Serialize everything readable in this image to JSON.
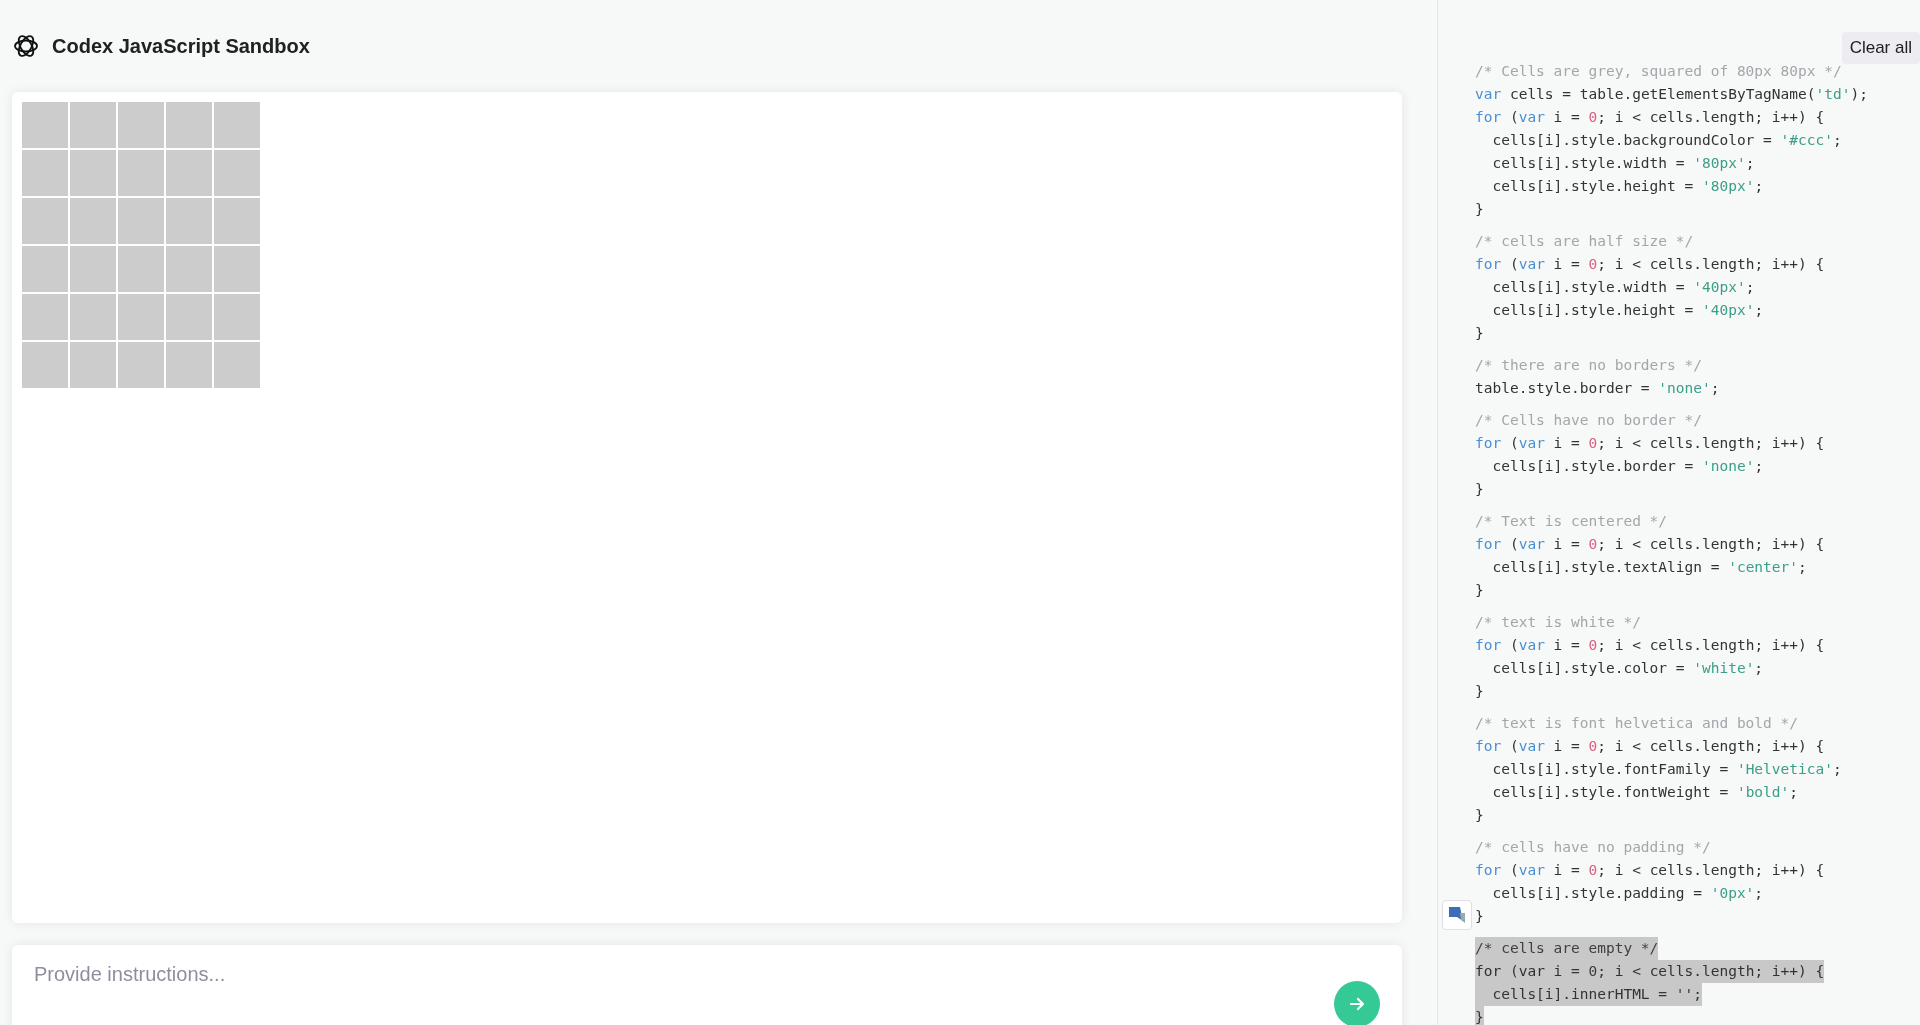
{
  "header": {
    "title": "Codex JavaScript Sandbox"
  },
  "prompt": {
    "placeholder": "Provide instructions..."
  },
  "code_panel": {
    "clear_button": "Clear all",
    "blocks": [
      {
        "selected": false,
        "lines": [
          [
            {
              "kind": "comment",
              "text": "/* Cells are grey, squared of 80px 80px */"
            }
          ],
          [
            {
              "kind": "keyword",
              "text": "var"
            },
            {
              "kind": "plain",
              "text": " cells = table.getElementsByTagName("
            },
            {
              "kind": "string",
              "text": "'td'"
            },
            {
              "kind": "plain",
              "text": ");"
            }
          ],
          [
            {
              "kind": "keyword",
              "text": "for"
            },
            {
              "kind": "plain",
              "text": " ("
            },
            {
              "kind": "keyword",
              "text": "var"
            },
            {
              "kind": "plain",
              "text": " i = "
            },
            {
              "kind": "number",
              "text": "0"
            },
            {
              "kind": "plain",
              "text": "; i < cells.length; i++) {"
            }
          ],
          [
            {
              "kind": "plain",
              "text": "  cells[i].style.backgroundColor = "
            },
            {
              "kind": "string",
              "text": "'#ccc'"
            },
            {
              "kind": "plain",
              "text": ";"
            }
          ],
          [
            {
              "kind": "plain",
              "text": "  cells[i].style.width = "
            },
            {
              "kind": "string",
              "text": "'80px'"
            },
            {
              "kind": "plain",
              "text": ";"
            }
          ],
          [
            {
              "kind": "plain",
              "text": "  cells[i].style.height = "
            },
            {
              "kind": "string",
              "text": "'80px'"
            },
            {
              "kind": "plain",
              "text": ";"
            }
          ],
          [
            {
              "kind": "plain",
              "text": "}"
            }
          ]
        ]
      },
      {
        "selected": false,
        "lines": [
          [
            {
              "kind": "comment",
              "text": "/* cells are half size */"
            }
          ],
          [
            {
              "kind": "keyword",
              "text": "for"
            },
            {
              "kind": "plain",
              "text": " ("
            },
            {
              "kind": "keyword",
              "text": "var"
            },
            {
              "kind": "plain",
              "text": " i = "
            },
            {
              "kind": "number",
              "text": "0"
            },
            {
              "kind": "plain",
              "text": "; i < cells.length; i++) {"
            }
          ],
          [
            {
              "kind": "plain",
              "text": "  cells[i].style.width = "
            },
            {
              "kind": "string",
              "text": "'40px'"
            },
            {
              "kind": "plain",
              "text": ";"
            }
          ],
          [
            {
              "kind": "plain",
              "text": "  cells[i].style.height = "
            },
            {
              "kind": "string",
              "text": "'40px'"
            },
            {
              "kind": "plain",
              "text": ";"
            }
          ],
          [
            {
              "kind": "plain",
              "text": "}"
            }
          ]
        ]
      },
      {
        "selected": false,
        "lines": [
          [
            {
              "kind": "comment",
              "text": "/* there are no borders */"
            }
          ],
          [
            {
              "kind": "plain",
              "text": "table.style.border = "
            },
            {
              "kind": "string",
              "text": "'none'"
            },
            {
              "kind": "plain",
              "text": ";"
            }
          ]
        ]
      },
      {
        "selected": false,
        "lines": [
          [
            {
              "kind": "comment",
              "text": "/* Cells have no border */"
            }
          ],
          [
            {
              "kind": "keyword",
              "text": "for"
            },
            {
              "kind": "plain",
              "text": " ("
            },
            {
              "kind": "keyword",
              "text": "var"
            },
            {
              "kind": "plain",
              "text": " i = "
            },
            {
              "kind": "number",
              "text": "0"
            },
            {
              "kind": "plain",
              "text": "; i < cells.length; i++) {"
            }
          ],
          [
            {
              "kind": "plain",
              "text": "  cells[i].style.border = "
            },
            {
              "kind": "string",
              "text": "'none'"
            },
            {
              "kind": "plain",
              "text": ";"
            }
          ],
          [
            {
              "kind": "plain",
              "text": "}"
            }
          ]
        ]
      },
      {
        "selected": false,
        "lines": [
          [
            {
              "kind": "comment",
              "text": "/* Text is centered */"
            }
          ],
          [
            {
              "kind": "keyword",
              "text": "for"
            },
            {
              "kind": "plain",
              "text": " ("
            },
            {
              "kind": "keyword",
              "text": "var"
            },
            {
              "kind": "plain",
              "text": " i = "
            },
            {
              "kind": "number",
              "text": "0"
            },
            {
              "kind": "plain",
              "text": "; i < cells.length; i++) {"
            }
          ],
          [
            {
              "kind": "plain",
              "text": "  cells[i].style.textAlign = "
            },
            {
              "kind": "string",
              "text": "'center'"
            },
            {
              "kind": "plain",
              "text": ";"
            }
          ],
          [
            {
              "kind": "plain",
              "text": "}"
            }
          ]
        ]
      },
      {
        "selected": false,
        "lines": [
          [
            {
              "kind": "comment",
              "text": "/* text is white */"
            }
          ],
          [
            {
              "kind": "keyword",
              "text": "for"
            },
            {
              "kind": "plain",
              "text": " ("
            },
            {
              "kind": "keyword",
              "text": "var"
            },
            {
              "kind": "plain",
              "text": " i = "
            },
            {
              "kind": "number",
              "text": "0"
            },
            {
              "kind": "plain",
              "text": "; i < cells.length; i++) {"
            }
          ],
          [
            {
              "kind": "plain",
              "text": "  cells[i].style.color = "
            },
            {
              "kind": "string",
              "text": "'white'"
            },
            {
              "kind": "plain",
              "text": ";"
            }
          ],
          [
            {
              "kind": "plain",
              "text": "}"
            }
          ]
        ]
      },
      {
        "selected": false,
        "lines": [
          [
            {
              "kind": "comment",
              "text": "/* text is font helvetica and bold */"
            }
          ],
          [
            {
              "kind": "keyword",
              "text": "for"
            },
            {
              "kind": "plain",
              "text": " ("
            },
            {
              "kind": "keyword",
              "text": "var"
            },
            {
              "kind": "plain",
              "text": " i = "
            },
            {
              "kind": "number",
              "text": "0"
            },
            {
              "kind": "plain",
              "text": "; i < cells.length; i++) {"
            }
          ],
          [
            {
              "kind": "plain",
              "text": "  cells[i].style.fontFamily = "
            },
            {
              "kind": "string",
              "text": "'Helvetica'"
            },
            {
              "kind": "plain",
              "text": ";"
            }
          ],
          [
            {
              "kind": "plain",
              "text": "  cells[i].style.fontWeight = "
            },
            {
              "kind": "string",
              "text": "'bold'"
            },
            {
              "kind": "plain",
              "text": ";"
            }
          ],
          [
            {
              "kind": "plain",
              "text": "}"
            }
          ]
        ]
      },
      {
        "selected": false,
        "lines": [
          [
            {
              "kind": "comment",
              "text": "/* cells have no padding */"
            }
          ],
          [
            {
              "kind": "keyword",
              "text": "for"
            },
            {
              "kind": "plain",
              "text": " ("
            },
            {
              "kind": "keyword",
              "text": "var"
            },
            {
              "kind": "plain",
              "text": " i = "
            },
            {
              "kind": "number",
              "text": "0"
            },
            {
              "kind": "plain",
              "text": "; i < cells.length; i++) {"
            }
          ],
          [
            {
              "kind": "plain",
              "text": "  cells[i].style.padding = "
            },
            {
              "kind": "string",
              "text": "'0px'"
            },
            {
              "kind": "plain",
              "text": ";"
            }
          ],
          [
            {
              "kind": "plain",
              "text": "}"
            }
          ]
        ]
      },
      {
        "selected": true,
        "lines": [
          [
            {
              "kind": "comment",
              "text": "/* cells are empty */"
            }
          ],
          [
            {
              "kind": "keyword",
              "text": "for"
            },
            {
              "kind": "plain",
              "text": " ("
            },
            {
              "kind": "keyword",
              "text": "var"
            },
            {
              "kind": "plain",
              "text": " i = "
            },
            {
              "kind": "number",
              "text": "0"
            },
            {
              "kind": "plain",
              "text": "; i < cells.length; i++) {"
            }
          ],
          [
            {
              "kind": "plain",
              "text": "  cells[i].innerHTML = "
            },
            {
              "kind": "string",
              "text": "''"
            },
            {
              "kind": "plain",
              "text": ";"
            }
          ],
          [
            {
              "kind": "plain",
              "text": "}"
            }
          ]
        ]
      }
    ]
  }
}
